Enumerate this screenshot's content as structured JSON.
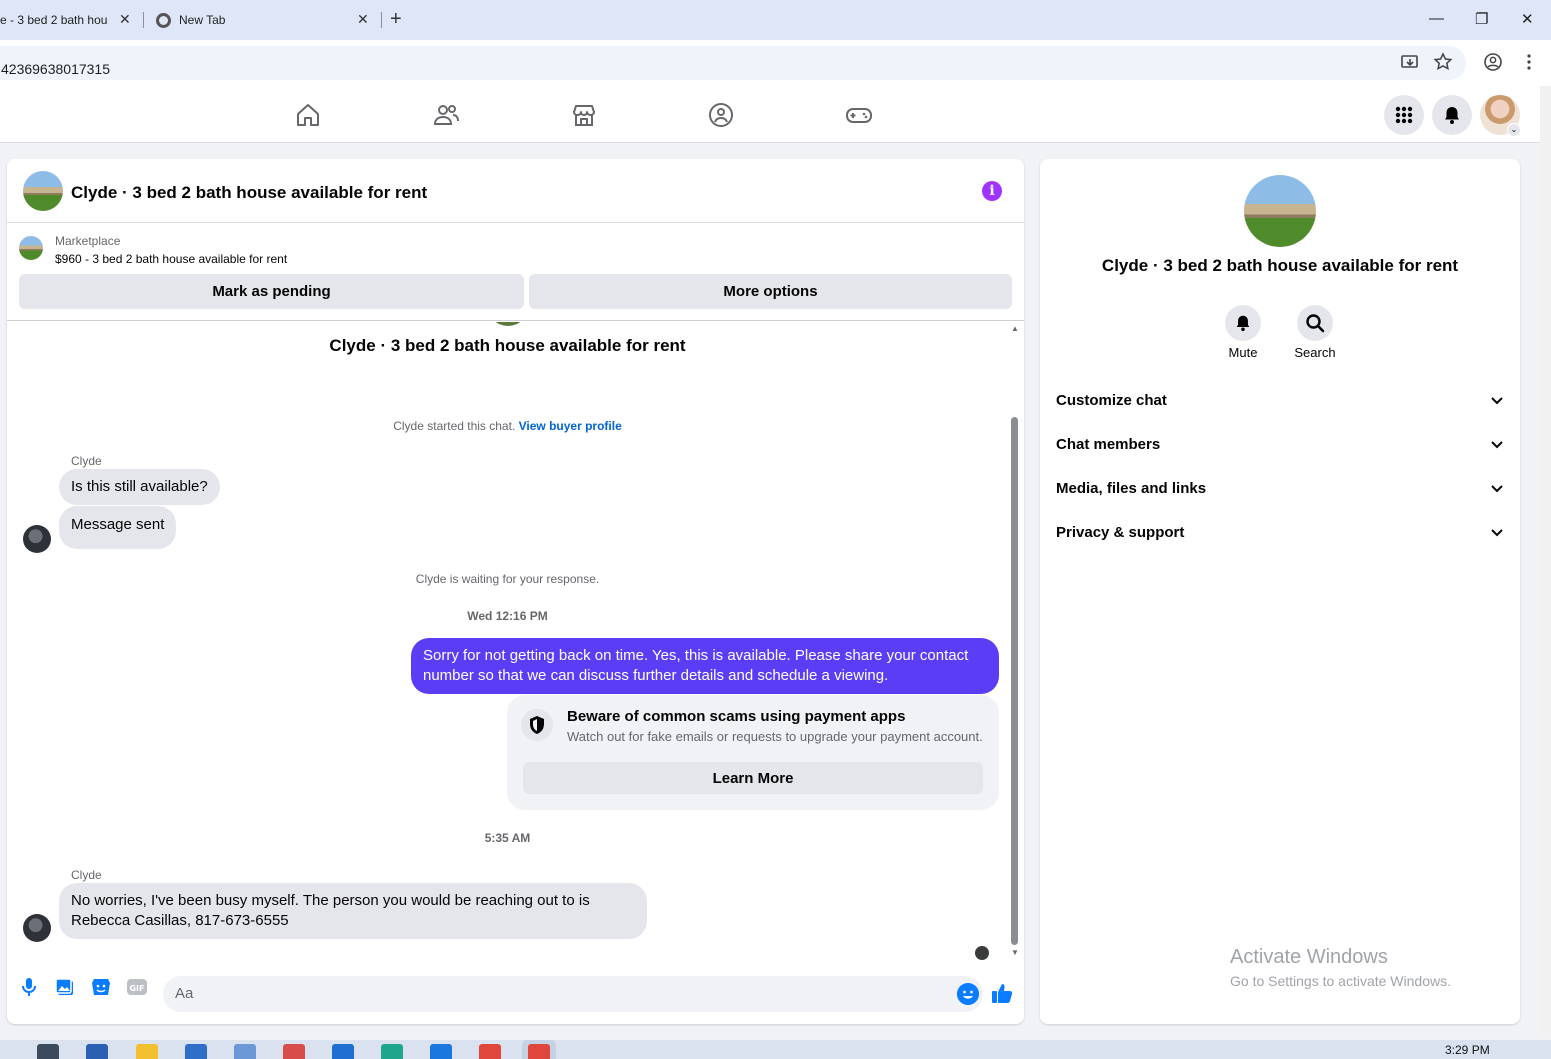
{
  "browser": {
    "tabs": [
      {
        "label": "e - 3 bed 2 bath hou"
      },
      {
        "label": "New Tab"
      }
    ],
    "url": "42369638017315"
  },
  "chat": {
    "header_title": "Clyde · 3 bed 2 bath house available for rent",
    "listing": {
      "source": "Marketplace",
      "title": "$960 - 3 bed 2 bath house available for rent"
    },
    "buttons": {
      "mark_pending": "Mark as pending",
      "more_options": "More options"
    },
    "conversation_title": "Clyde · 3 bed 2 bath house available for rent",
    "started_text": "Clyde started this chat.",
    "view_profile_link": "View buyer profile",
    "messages": [
      {
        "sender": "Clyde",
        "text": "Is this still available?"
      },
      {
        "text": "Message sent"
      },
      {
        "text": "Sorry for not getting back on time. Yes, this is available. Please share your contact number so that we can discuss further details and schedule a viewing."
      },
      {
        "sender": "Clyde",
        "text": "No worries, I've been busy myself. The person you would be reaching out to is Rebecca Casillas, 817-673-6555"
      }
    ],
    "waiting_text": "Clyde is waiting for your response.",
    "timestamps": [
      "Wed 12:16 PM",
      "5:35 AM"
    ],
    "scam_warning": {
      "title": "Beware of common scams using payment apps",
      "description": "Watch out for fake emails or requests to upgrade your payment account.",
      "button": "Learn More"
    },
    "composer_placeholder": "Aa"
  },
  "info_panel": {
    "title": "Clyde · 3 bed 2 bath house available for rent",
    "actions": [
      {
        "label": "Mute",
        "icon": "bell-icon"
      },
      {
        "label": "Search",
        "icon": "search-icon"
      }
    ],
    "sections": [
      {
        "label": "Customize chat"
      },
      {
        "label": "Chat members"
      },
      {
        "label": "Media, files and links"
      },
      {
        "label": "Privacy & support"
      }
    ]
  },
  "watermark": {
    "title": "Activate Windows",
    "subtitle": "Go to Settings to activate Windows."
  },
  "taskbar": {
    "clock": "3:29 PM"
  },
  "colors": {
    "outgoing_bubble": "#5b3df5",
    "accent_blue": "#0a7cff",
    "info_purple": "#a033ff"
  }
}
